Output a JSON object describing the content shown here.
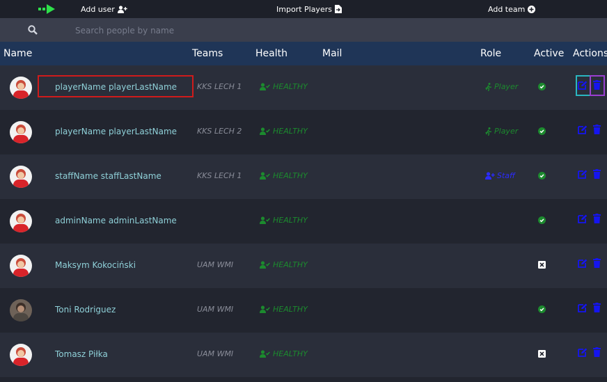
{
  "toolbar": {
    "add_user_label": "Add user",
    "import_label": "Import Players",
    "add_team_label": "Add team"
  },
  "search": {
    "placeholder": "Search people by name"
  },
  "table": {
    "headers": {
      "name": "Name",
      "teams": "Teams",
      "health": "Health",
      "mail": "Mail",
      "role": "Role",
      "active": "Active",
      "actions": "Actions"
    },
    "rows": [
      {
        "name": "playerName playerLastName",
        "team": "KKS LECH 1",
        "health": "HEALTHY",
        "role": "Player",
        "active": true
      },
      {
        "name": "playerName playerLastName",
        "team": "KKS LECH 2",
        "health": "HEALTHY",
        "role": "Player",
        "active": true
      },
      {
        "name": "staffName staffLastName",
        "team": "KKS LECH 1",
        "health": "HEALTHY",
        "role": "Staff",
        "active": true
      },
      {
        "name": "adminName adminLastName",
        "team": "",
        "health": "HEALTHY",
        "role": "",
        "active": true
      },
      {
        "name": "Maksym Kokociński",
        "team": "UAM WMI",
        "health": "HEALTHY",
        "role": "",
        "active": false
      },
      {
        "name": "Toni Rodriguez",
        "team": "UAM WMI",
        "health": "HEALTHY",
        "role": "",
        "active": true
      },
      {
        "name": "Tomasz Piłka",
        "team": "UAM WMI",
        "health": "HEALTHY",
        "role": "",
        "active": false
      }
    ]
  },
  "colors": {
    "healthy": "#1c8a2e",
    "staff": "#2b2bff",
    "header_bg": "#1f3557",
    "name_text": "#8fd0d8"
  }
}
